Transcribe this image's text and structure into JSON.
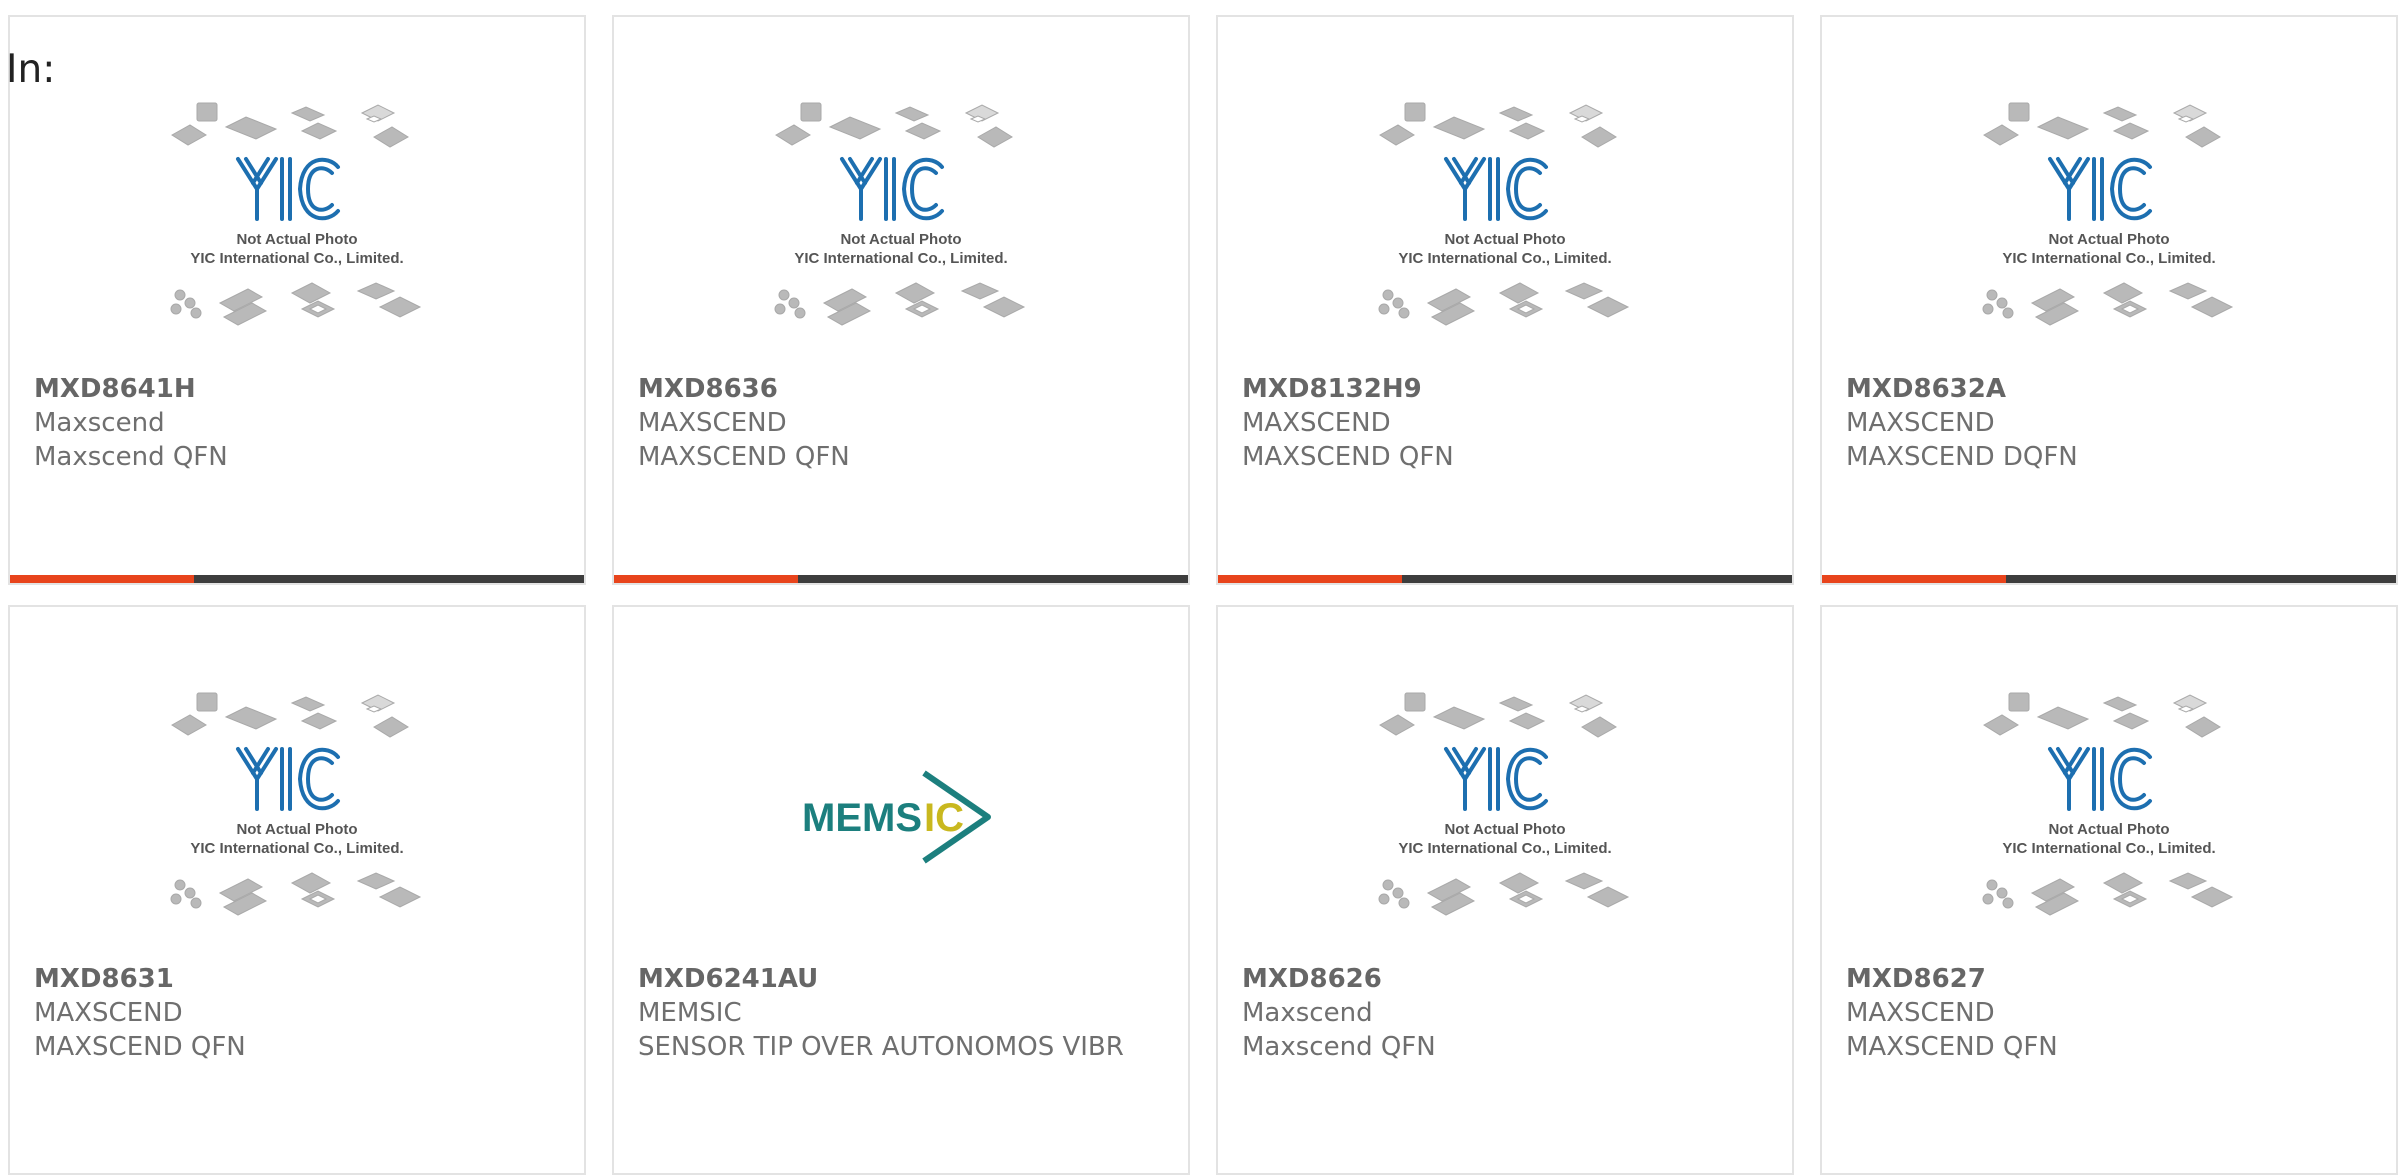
{
  "page": {
    "label": "In:"
  },
  "placeholder_image": {
    "line1": "Not Actual Photo",
    "line2": "YIC International Co., Limited.",
    "logo_text": "YIC",
    "logo_color": "#1d6fb0"
  },
  "memsic_logo": {
    "text_a": "MEMS",
    "text_b": "IC",
    "color_a": "#1c7f7e",
    "color_b": "#c9b81f"
  },
  "accent": {
    "bar_fill": "#e8441c",
    "bar_track": "#3d3d3d",
    "bar_fill_fraction": 0.32
  },
  "products": [
    {
      "part": "MXD8641H",
      "manufacturer": "Maxscend",
      "description": "Maxscend QFN",
      "image": "yic-placeholder"
    },
    {
      "part": "MXD8636",
      "manufacturer": "MAXSCEND",
      "description": "MAXSCEND QFN",
      "image": "yic-placeholder"
    },
    {
      "part": "MXD8132H9",
      "manufacturer": "MAXSCEND",
      "description": "MAXSCEND QFN",
      "image": "yic-placeholder"
    },
    {
      "part": "MXD8632A",
      "manufacturer": "MAXSCEND",
      "description": "MAXSCEND DQFN",
      "image": "yic-placeholder"
    },
    {
      "part": "MXD8631",
      "manufacturer": "MAXSCEND",
      "description": "MAXSCEND QFN",
      "image": "yic-placeholder"
    },
    {
      "part": "MXD6241AU",
      "manufacturer": "MEMSIC",
      "description": "SENSOR TIP OVER AUTONOMOS VIBR",
      "image": "memsic-logo"
    },
    {
      "part": "MXD8626",
      "manufacturer": "Maxscend",
      "description": "Maxscend QFN",
      "image": "yic-placeholder"
    },
    {
      "part": "MXD8627",
      "manufacturer": "MAXSCEND",
      "description": "MAXSCEND QFN",
      "image": "yic-placeholder"
    }
  ]
}
